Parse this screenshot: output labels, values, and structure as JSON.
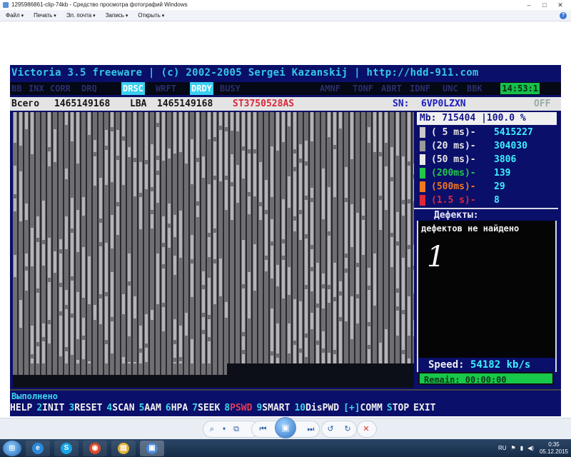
{
  "window": {
    "title": "1295986861-clip-74kb - Средство просмотра фотографий Windows",
    "min": "–",
    "max": "□",
    "close": "✕"
  },
  "menu": [
    "Файл",
    "Печать",
    "Эл. почта",
    "Запись",
    "Открыть"
  ],
  "victoria": {
    "title": "Victoria 3.5 freeware | (c) 2002-2005 Sergei Kazanskij | http://hdd-911.com",
    "flags": [
      {
        "label": "BB",
        "on": false
      },
      {
        "label": "INX",
        "on": false
      },
      {
        "label": "CORR",
        "on": false
      },
      {
        "label": "DRQ",
        "on": false
      },
      {
        "label": "DRSC",
        "on": true
      },
      {
        "label": "WRFT",
        "on": false
      },
      {
        "label": "DRDY",
        "on": true
      },
      {
        "label": "BUSY",
        "on": false
      },
      {
        "label": "AMNF",
        "on": false
      },
      {
        "label": "TONF",
        "on": false
      },
      {
        "label": "ABRT",
        "on": false
      },
      {
        "label": "IDNF",
        "on": false
      },
      {
        "label": "UNC",
        "on": false
      },
      {
        "label": "BBK",
        "on": false
      }
    ],
    "clock": "14:53:1",
    "info": {
      "total_label": "Всего",
      "total_value": "1465149168",
      "lba_label": "LBA",
      "lba_value": "1465149168",
      "model": "ST3750528AS",
      "sn_label": "SN:",
      "sn_value": "6VP0LZXN",
      "off": "OFF"
    },
    "mb_line": "Mb: 715404 |100.0 %",
    "timings": [
      {
        "label": "( 5 ms)-",
        "count": "5415227",
        "color": "#c8c8c8",
        "label_color": "#e8e8e8"
      },
      {
        "label": "(20 ms)-",
        "count": "304030",
        "color": "#9a9a9a",
        "label_color": "#e8e8e8"
      },
      {
        "label": "(50 ms)-",
        "count": "3806",
        "color": "#e8e8e8",
        "label_color": "#e8e8e8"
      },
      {
        "label": "(200ms)-",
        "count": "139",
        "color": "#22c84a",
        "label_color": "#22c84a"
      },
      {
        "label": "(500ms)-",
        "count": "29",
        "color": "#f07820",
        "label_color": "#f07820"
      },
      {
        "label": "(1.5 s)-",
        "count": "8",
        "color": "#e0283c",
        "label_color": "#e0283c"
      }
    ],
    "defects_title": "Дефекты:",
    "defects_text": "дефектов не найдено",
    "handwritten": "1",
    "speed_label": "Speed:",
    "speed_value": "54182 kb/s",
    "remain": "Remain: 00:00:00",
    "status": "Выполнено",
    "fkeys": [
      {
        "n": "",
        "l": "HELP",
        "red": false
      },
      {
        "n": "2",
        "l": "INIT",
        "red": false
      },
      {
        "n": "3",
        "l": "RESET",
        "red": false
      },
      {
        "n": "4",
        "l": "SCAN",
        "red": false
      },
      {
        "n": "5",
        "l": "AAM",
        "red": false
      },
      {
        "n": "6",
        "l": "HPA",
        "red": false
      },
      {
        "n": "7",
        "l": "SEEK",
        "red": false
      },
      {
        "n": "8",
        "l": "PSWD",
        "red": true
      },
      {
        "n": "9",
        "l": "SMART",
        "red": false
      },
      {
        "n": "10",
        "l": "DisPWD",
        "red": false
      },
      {
        "n": "[+]",
        "l": "COMM",
        "red": false
      },
      {
        "n": "S",
        "l": "TOP",
        "red": false
      },
      {
        "n": "",
        "l": "EXIT",
        "red": false
      }
    ]
  },
  "toolbar": {
    "zoom_icon": "zoom-icon",
    "buttons": [
      "⌕",
      "⧉",
      "⏮",
      "▣",
      "⏭",
      "↺",
      "↻",
      "✕"
    ]
  },
  "taskbar": {
    "apps": [
      {
        "icon": "ie-icon",
        "glyph": "e",
        "color": "#2a8ad8"
      },
      {
        "icon": "skype-icon",
        "glyph": "S",
        "color": "#14a6e6"
      },
      {
        "icon": "chrome-icon",
        "glyph": "◉",
        "color": "#d84a2c"
      },
      {
        "icon": "explorer-icon",
        "glyph": "▤",
        "color": "#e2b33a"
      },
      {
        "icon": "photo-viewer-icon",
        "glyph": "▣",
        "color": "#4a8ad8"
      }
    ],
    "lang": "RU",
    "time": "0:35",
    "date": "05.12.2015"
  }
}
